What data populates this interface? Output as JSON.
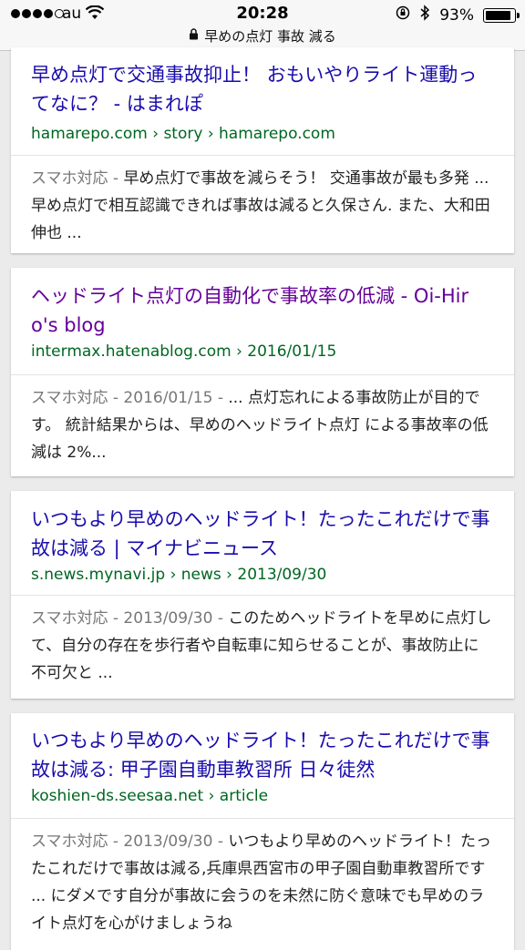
{
  "status_bar": {
    "carrier": "au",
    "time": "20:28",
    "battery_percent": "93%",
    "battery_level": 0.93
  },
  "url_bar": {
    "query": "早めの点灯 事故 減る"
  },
  "results": [
    {
      "title": "早め点灯で交通事故抑止！ おもいやりライト運動ってなに？ - はまれぽ",
      "url": "hamarepo.com › story › hamarepo.com",
      "meta": "スマホ対応 - ",
      "snippet": "早め点灯で事故を減らそう！ 交通事故が最も多発 ... 早め点灯で相互認識できれば事故は減ると久保さん. また、大和田伸也 ..."
    },
    {
      "title": "ヘッドライト点灯の自動化で事故率の低減 - Oi-Hiro's blog",
      "url": "intermax.hatenablog.com › 2016/01/15",
      "meta": "スマホ対応 - 2016/01/15 - ",
      "snippet": "... 点灯忘れによる事故防止が目的です。 統計結果からは、早めのヘッドライト点灯 による事故率の低減は 2%..."
    },
    {
      "title": "いつもより早めのヘッドライト！たったこれだけで事故は減る | マイナビニュース",
      "url": "s.news.mynavi.jp › news › 2013/09/30",
      "meta": "スマホ対応 - 2013/09/30 - ",
      "snippet": "このためヘッドライトを早めに点灯して、自分の存在を歩行者や自転車に知らせることが、事故防止に不可欠と ..."
    },
    {
      "title": "いつもより早めのヘッドライト！たったこれだけで事故は減る: 甲子園自動車教習所 日々徒然",
      "url": "koshien-ds.seesaa.net › article",
      "meta": "スマホ対応 - 2013/09/30 - ",
      "snippet": "いつもより早めのヘッドライト！たったこれだけで事故は減る,兵庫県西宮市の甲子園自動車教習所です ... にダメです自分が事故に会うのを未然に防ぐ意味でも早めのライト点灯を心がけましょうね"
    }
  ],
  "colors": {
    "link": "#1a0dab",
    "visited_link": "#660099",
    "url_green": "#006621",
    "background": "#ebebeb"
  },
  "icons": [
    "signal-dots-icon",
    "wifi-icon",
    "lock-icon",
    "orientation-lock-icon",
    "bluetooth-icon",
    "battery-icon"
  ]
}
